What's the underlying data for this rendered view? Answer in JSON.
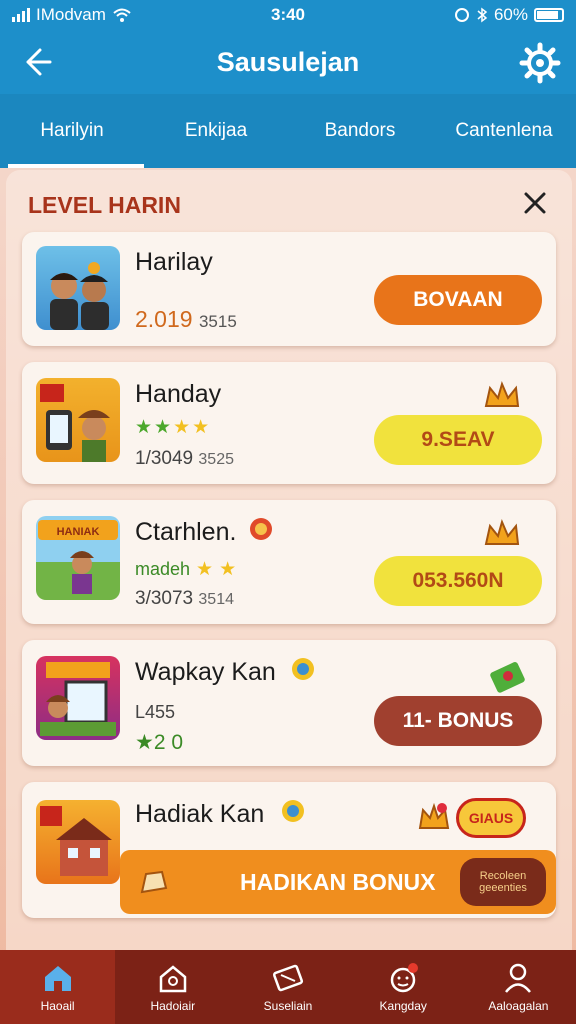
{
  "status_bar": {
    "carrier": "IModvam",
    "time": "3:40",
    "battery": "60%"
  },
  "header": {
    "title": "Sausulejan"
  },
  "tabs": [
    {
      "label": "Harilyin",
      "active": true
    },
    {
      "label": "Enkijaa",
      "active": false
    },
    {
      "label": "Bandors",
      "active": false
    },
    {
      "label": "Cantenlena",
      "active": false
    }
  ],
  "panel": {
    "title": "LEVEL HARIN"
  },
  "cards": [
    {
      "name": "Harilay",
      "line1_main": "2.019",
      "line1_extra": "3515",
      "stars": 0,
      "action": "BOVAAN",
      "action_color": "#e8741a"
    },
    {
      "name": "Handay",
      "line1_main": "1/3049",
      "line1_extra": "3525",
      "stars": 4,
      "action": "9.SEAV",
      "action_color": "#f1e23d"
    },
    {
      "name": "Ctarhlen.",
      "tag": "madeh",
      "line1_main": "3/3073",
      "line1_extra": "3514",
      "stars": 2,
      "action": "053.560N",
      "action_color": "#f1e23d"
    },
    {
      "name": "Wapkay Kan",
      "tag": "L455",
      "rating": "★2 0",
      "action": "11- BONUS",
      "action_color": "#a0402f"
    },
    {
      "name": "Hadiak Kan",
      "banner": "HADIKAN BONUX",
      "badge_text": "GIAUS",
      "mini_label": "Recoleen geeenties"
    }
  ],
  "bottom_nav": [
    {
      "label": "Haoail",
      "icon": "home-icon",
      "active": true
    },
    {
      "label": "Hadoiair",
      "icon": "house-outline-icon",
      "active": false
    },
    {
      "label": "Suseliain",
      "icon": "ticket-icon",
      "active": false
    },
    {
      "label": "Kangday",
      "icon": "bell-face-icon",
      "active": false
    },
    {
      "label": "Aaloagalan",
      "icon": "profile-icon",
      "active": false
    }
  ]
}
